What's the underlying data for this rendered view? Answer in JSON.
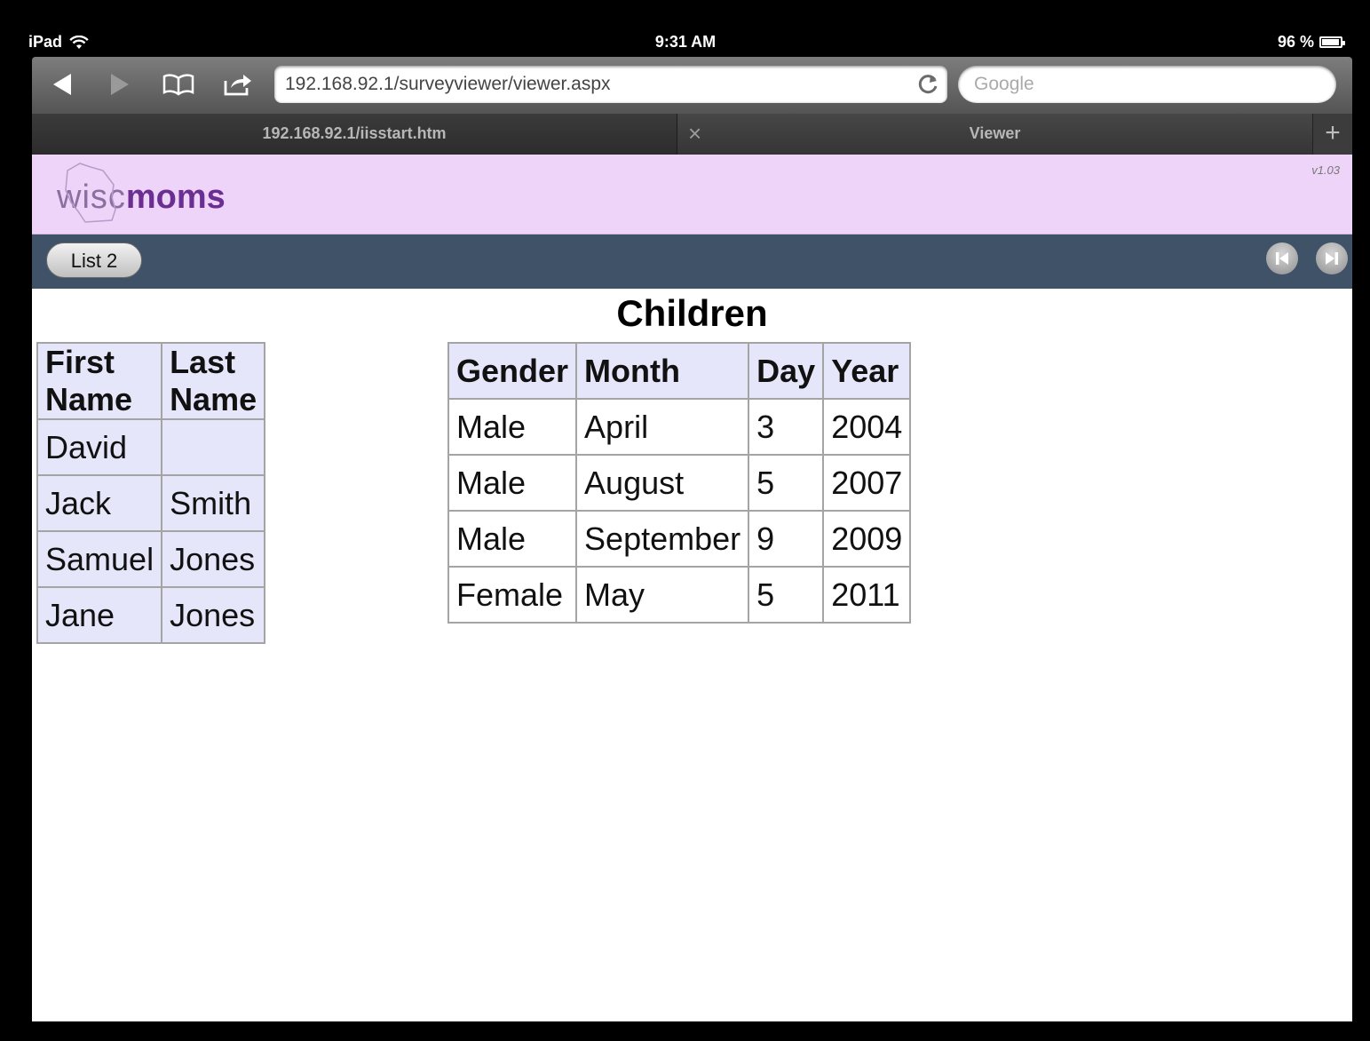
{
  "status_bar": {
    "device": "iPad",
    "time": "9:31 AM",
    "battery": "96 %",
    "battery_level": 0.96
  },
  "browser": {
    "url": "192.168.92.1/surveyviewer/viewer.aspx",
    "search_placeholder": "Google",
    "tabs": [
      {
        "label": "192.168.92.1/iisstart.htm"
      },
      {
        "label": "Viewer"
      }
    ],
    "new_tab_label": "+",
    "close_tab_label": "×"
  },
  "site": {
    "logo_wisc": "wisc",
    "logo_moms": "moms",
    "version": "v1.03"
  },
  "nav": {
    "list_button": "List 2"
  },
  "page_title": "Children",
  "table": {
    "headers": [
      "First Name",
      "Last Name",
      "Gender",
      "Month",
      "Day",
      "Year"
    ],
    "rows": [
      [
        "David",
        "",
        "Male",
        "April",
        "3",
        "2004"
      ],
      [
        "Jack",
        "Smith",
        "Male",
        "August",
        "5",
        "2007"
      ],
      [
        "Samuel",
        "Jones",
        "Male",
        "September",
        "9",
        "2009"
      ],
      [
        "Jane",
        "Jones",
        "Female",
        "May",
        "5",
        "2011"
      ]
    ]
  },
  "colors": {
    "header_bg": "#efd4fa",
    "nav_bg": "#3f5268",
    "grid_header_bg": "#e6e6fa",
    "logo_accent": "#6b2f92"
  }
}
